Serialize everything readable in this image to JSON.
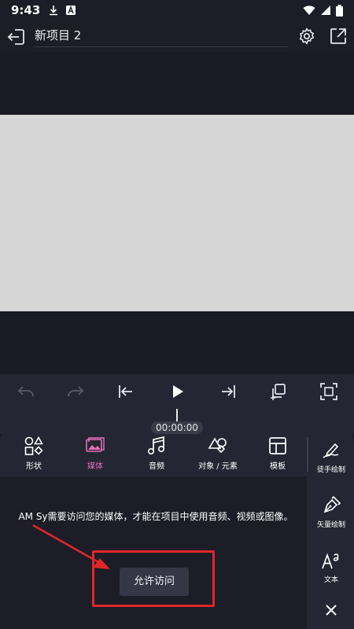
{
  "status": {
    "time": "9:43"
  },
  "app_bar": {
    "title": "新项目 2"
  },
  "transport": {
    "timecode": "00:00:00"
  },
  "categories": [
    {
      "id": "shape",
      "label": "形状",
      "active": false
    },
    {
      "id": "media",
      "label": "媒体",
      "active": true
    },
    {
      "id": "audio",
      "label": "音频",
      "active": false
    },
    {
      "id": "objects",
      "label": "对象 / 元素",
      "active": false
    },
    {
      "id": "template",
      "label": "模板",
      "active": false
    }
  ],
  "side_tools": [
    {
      "id": "freehand",
      "label": "徒手绘制"
    },
    {
      "id": "vector",
      "label": "矢量绘制"
    },
    {
      "id": "text",
      "label": "文本"
    }
  ],
  "permission": {
    "message": "AM Sy需要访问您的媒体，才能在项目中使用音频、视频或图像。",
    "button_label": "允许访问"
  },
  "colors": {
    "accent": "#e56fb8",
    "highlight": "#e0262b",
    "canvas": "#d6d6d6",
    "background": "#1c1d26"
  }
}
